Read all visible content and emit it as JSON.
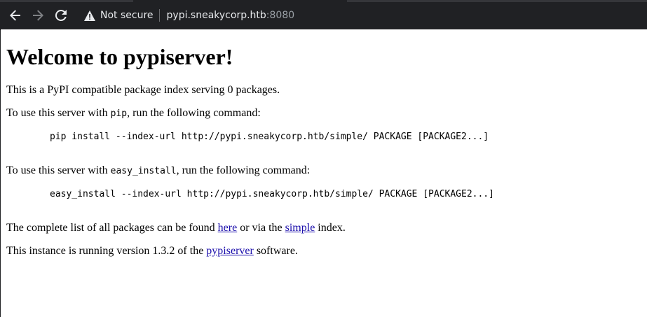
{
  "browser": {
    "security_label": "Not secure",
    "url_host": "pypi.sneakycorp.htb",
    "url_port": ":8080",
    "icons": {
      "back": "back-arrow-icon",
      "forward": "forward-arrow-icon",
      "reload": "reload-icon",
      "security": "warning-icon"
    }
  },
  "page": {
    "title": "Welcome to pypiserver!",
    "intro": "This is a PyPI compatible package index serving 0 packages.",
    "pip": {
      "before": "To use this server with ",
      "code": "pip",
      "after": ", run the following command:",
      "command": "pip install --index-url http://pypi.sneakycorp.htb/simple/ PACKAGE [PACKAGE2...]"
    },
    "easy_install": {
      "before": "To use this server with ",
      "code": "easy_install",
      "after": ", run the following command:",
      "command": "easy_install --index-url http://pypi.sneakycorp.htb/simple/ PACKAGE [PACKAGE2...]"
    },
    "list": {
      "before": "The complete list of all packages can be found ",
      "here_link": "here",
      "middle": " or via the ",
      "simple_link": "simple",
      "after": " index."
    },
    "version": {
      "before": "This instance is running version 1.3.2 of the ",
      "link": "pypiserver",
      "after": " software."
    }
  },
  "colors": {
    "chrome_bg": "#202124",
    "page_bg": "#ffffff",
    "link": "#1a0dab"
  }
}
